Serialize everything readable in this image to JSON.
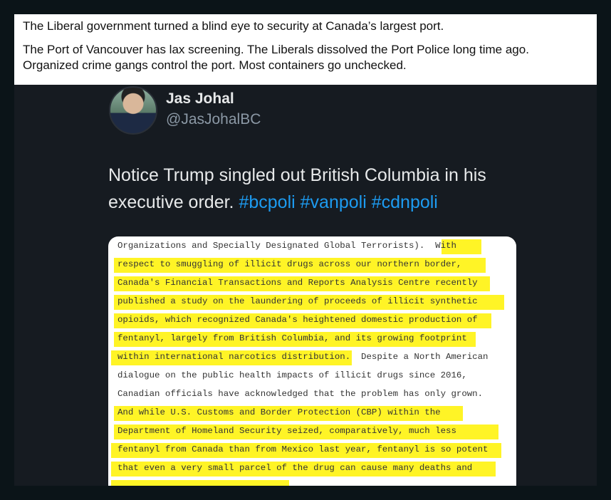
{
  "caption": {
    "line1": "The Liberal government turned a blind eye to security at Canada’s largest port.",
    "line2": "The Port of Vancouver has lax screening.  The Liberals dissolved the Port Police long time ago.",
    "line3": "Organized crime gangs control the port.  Most containers go unchecked."
  },
  "tweet": {
    "name": "Jas Johal",
    "handle": "@JasJohalBC",
    "text": "Notice Trump singled out British Columbia in his executive order.",
    "hashtags": [
      "#bcpoli",
      "#vanpoli",
      "#cdnpoli"
    ]
  },
  "document": {
    "lines": [
      "Organizations and Specially Designated Global Terrorists).  With",
      "respect to smuggling of illicit drugs across our northern border,",
      "Canada's Financial Transactions and Reports Analysis Centre recently",
      "published a study on the laundering of proceeds of illicit synthetic",
      "opioids, which recognized Canada's heightened domestic production of",
      "fentanyl, largely from British Columbia, and its growing footprint",
      "within international narcotics distribution.  Despite a North American",
      "dialogue on the public health impacts of illicit drugs since 2016,",
      "Canadian officials have acknowledged that the problem has only grown.",
      "And while U.S. Customs and Border Protection (CBP) within the",
      "Department of Homeland Security seized, comparatively, much less",
      "fentanyl from Canada than from Mexico last year, fentanyl is so potent",
      "that even a very small parcel of the drug can cause many deaths and"
    ]
  },
  "colors": {
    "background": "#0b1418",
    "tweet_bg": "#161b21",
    "hashtag": "#1d9bf0",
    "highlight": "#fff200"
  }
}
